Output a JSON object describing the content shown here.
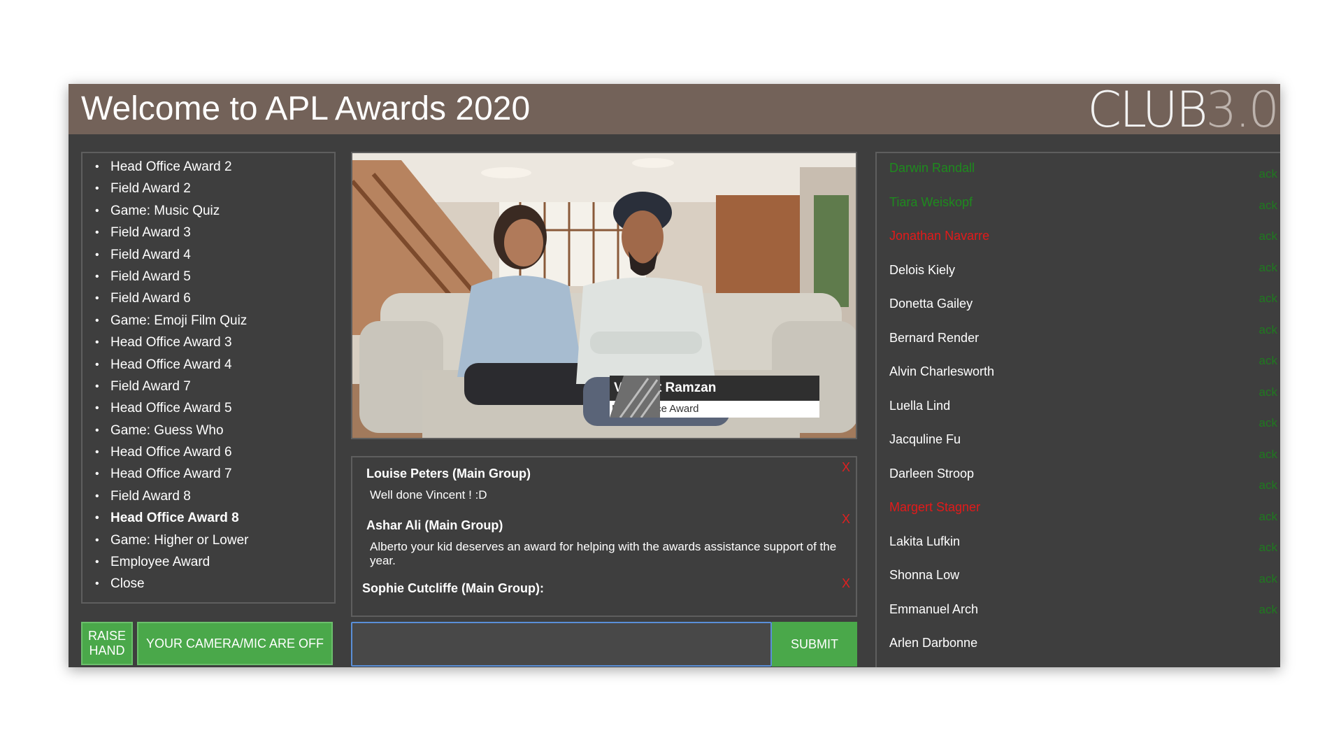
{
  "header": {
    "title": "Welcome to APL Awards 2020",
    "logo_main": "CLUB",
    "logo_suffix": "3.0"
  },
  "agenda": {
    "items": [
      "Head Office Award 2",
      "Field Award 2",
      "Game: Music Quiz",
      "Field Award 3",
      "Field Award 4",
      "Field Award 5",
      "Field Award 6",
      "Game: Emoji Film Quiz",
      "Head Office Award 3",
      "Head Office Award 4",
      "Field Award 7",
      "Head Office Award 5",
      "Game: Guess Who",
      "Head Office Award 6",
      "Head Office Award 7",
      "Field Award 8",
      "Head Office Award 8",
      "Game: Higher or Lower",
      "Employee Award",
      "Close"
    ],
    "active_item": "Head Office Award 8"
  },
  "controls": {
    "raise_hand": "RAISE HAND",
    "camera_status": "YOUR CAMERA/MIC ARE OFF",
    "submit": "SUBMIT"
  },
  "video": {
    "name": "Vincent Ramzan",
    "award": "Head Office Award"
  },
  "chat": {
    "messages": [
      {
        "author": "Louise Peters (Main Group)",
        "text": "Well done Vincent ! :D"
      },
      {
        "author": "Ashar Ali (Main Group)",
        "text": "Alberto your kid deserves an award for helping with the awards assistance support of the year."
      },
      {
        "author": "Sophie Cutcliffe (Main Group):",
        "text": ""
      }
    ],
    "delete_glyph": "X"
  },
  "participants": {
    "ack_label": "ack",
    "people": [
      {
        "name": "Darwin Randall",
        "status": "green"
      },
      {
        "name": "Tiara Weiskopf",
        "status": "green"
      },
      {
        "name": "Jonathan Navarre",
        "status": "red"
      },
      {
        "name": "Delois Kiely",
        "status": "normal"
      },
      {
        "name": "Donetta Gailey",
        "status": "normal"
      },
      {
        "name": "Bernard Render",
        "status": "normal"
      },
      {
        "name": "Alvin Charlesworth",
        "status": "normal"
      },
      {
        "name": "Luella Lind",
        "status": "normal"
      },
      {
        "name": "Jacquline Fu",
        "status": "normal"
      },
      {
        "name": "Darleen Stroop",
        "status": "normal"
      },
      {
        "name": "Margert Stagner",
        "status": "red"
      },
      {
        "name": "Lakita Lufkin",
        "status": "normal"
      },
      {
        "name": "Shonna Low",
        "status": "normal"
      },
      {
        "name": "Emmanuel Arch",
        "status": "normal"
      },
      {
        "name": "Arlen Darbonne",
        "status": "normal"
      }
    ],
    "colors": {
      "green": "#1e8a1e",
      "red": "#e31a1a",
      "normal": "#ffffff"
    }
  }
}
